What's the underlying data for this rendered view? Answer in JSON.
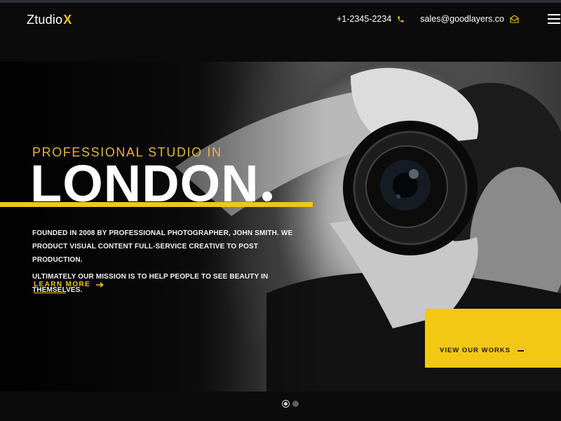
{
  "header": {
    "logo_text": "Ztudio",
    "logo_accent": "X",
    "phone": "+1-2345-2234",
    "email": "sales@goodlayers.co",
    "phone_icon": "phone-icon",
    "mail_icon": "envelope-open-icon",
    "menu_icon": "hamburger-icon"
  },
  "hero": {
    "eyebrow": "PROFESSIONAL STUDIO IN",
    "title": "LONDON",
    "paragraph_1": "FOUNDED IN 2008 BY PROFESSIONAL PHOTOGRAPHER, JOHN SMITH. WE PRODUCT VISUAL CONTENT FULL-SERVICE CREATIVE TO POST PRODUCTION.",
    "paragraph_2": "ULTIMATELY OUR MISSION IS TO HELP PEOPLE TO SEE BEAUTY IN THEMSELVES.",
    "cta_label": "LEARN MORE",
    "cta_icon": "arrow-right-icon"
  },
  "works_card": {
    "label": "VIEW OUR WORKS"
  },
  "slider": {
    "slide_count": 2,
    "active_index": 0
  },
  "colors": {
    "accent": "#f2c614",
    "eyebrow": "#e2b73c",
    "background": "#0b0b0b",
    "card_text": "#1a1a1a"
  }
}
